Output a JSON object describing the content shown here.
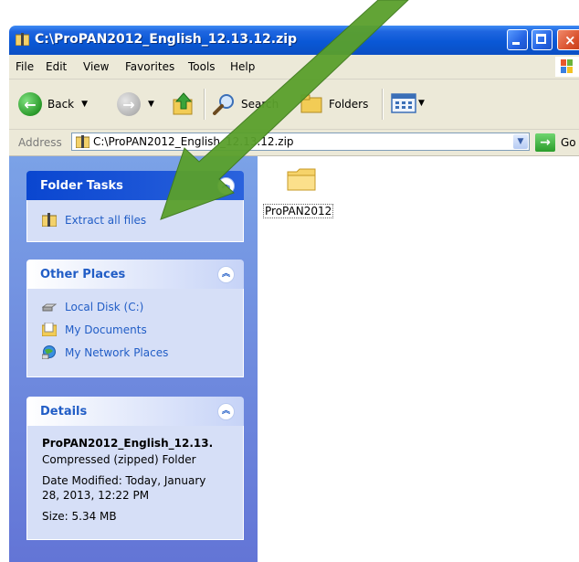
{
  "window": {
    "title": "C:\\ProPAN2012_English_12.13.12.zip",
    "buttons": {
      "minimize": "minimize",
      "maximize": "maximize",
      "close": "close"
    }
  },
  "menu": [
    "File",
    "Edit",
    "View",
    "Favorites",
    "Tools",
    "Help"
  ],
  "toolbar": {
    "back_label": "Back",
    "search_label": "Search",
    "folders_label": "Folders"
  },
  "address": {
    "label": "Address",
    "path": "C:\\ProPAN2012_English_12.13.12.zip",
    "go_label": "Go"
  },
  "task_pane": {
    "folder_tasks": {
      "title": "Folder Tasks",
      "items": [
        "Extract all files"
      ]
    },
    "other_places": {
      "title": "Other Places",
      "items": [
        "Local Disk (C:)",
        "My Documents",
        "My Network Places"
      ]
    },
    "details": {
      "title": "Details",
      "name": "ProPAN2012_English_12.13.",
      "type": "Compressed (zipped) Folder",
      "modified_line1": "Date Modified: Today, January",
      "modified_line2": "28, 2013, 12:22 PM",
      "size": "Size: 5.34 MB"
    }
  },
  "files": [
    {
      "name": "ProPAN2012",
      "icon": "folder-icon"
    }
  ],
  "colors": {
    "titlebar": "#0a58d6",
    "taskpane": "#7ba2e7",
    "link": "#215dc6",
    "arrow": "#5aa02c"
  }
}
